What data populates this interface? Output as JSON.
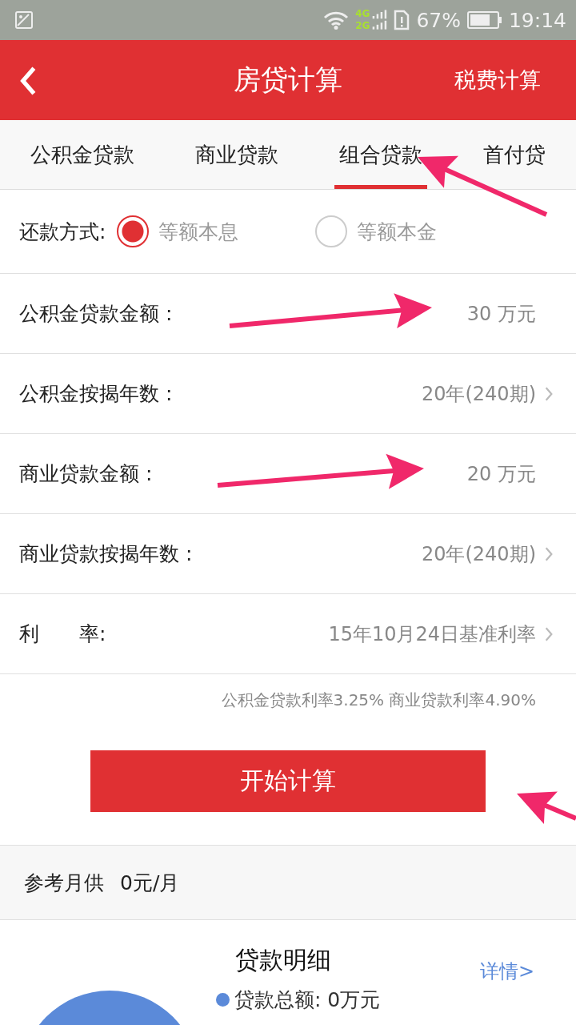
{
  "status_bar": {
    "network": [
      "4G",
      "2G"
    ],
    "battery": "67%",
    "time": "19:14"
  },
  "header": {
    "title": "房贷计算",
    "action": "税费计算"
  },
  "tabs": [
    {
      "label": "公积金贷款",
      "selected": false
    },
    {
      "label": "商业贷款",
      "selected": false
    },
    {
      "label": "组合贷款",
      "selected": true
    },
    {
      "label": "首付贷",
      "selected": false
    }
  ],
  "repayment": {
    "label": "还款方式:",
    "options": [
      {
        "label": "等额本息",
        "selected": true
      },
      {
        "label": "等额本金",
        "selected": false
      }
    ]
  },
  "fields": [
    {
      "label": "公积金贷款金额 :",
      "value": "30 万元",
      "chevron": false
    },
    {
      "label": "公积金按揭年数 :",
      "value": "20年(240期)",
      "chevron": true
    },
    {
      "label": "商业贷款金额 :",
      "value": "20 万元",
      "chevron": false
    },
    {
      "label": "商业贷款按揭年数 :",
      "value": "20年(240期)",
      "chevron": true
    },
    {
      "label": "利　　率:",
      "value": "15年10月24日基准利率",
      "chevron": true
    }
  ],
  "rate_note": "公积金贷款利率3.25% 商业贷款利率4.90%",
  "calculate_button": "开始计算",
  "monthly": {
    "label": "参考月供",
    "value": "0元/月"
  },
  "details": {
    "title": "贷款明细",
    "link": "详情>",
    "legend": [
      {
        "label": "贷款总额: 0万元",
        "color": "#5b8ad9"
      }
    ]
  }
}
